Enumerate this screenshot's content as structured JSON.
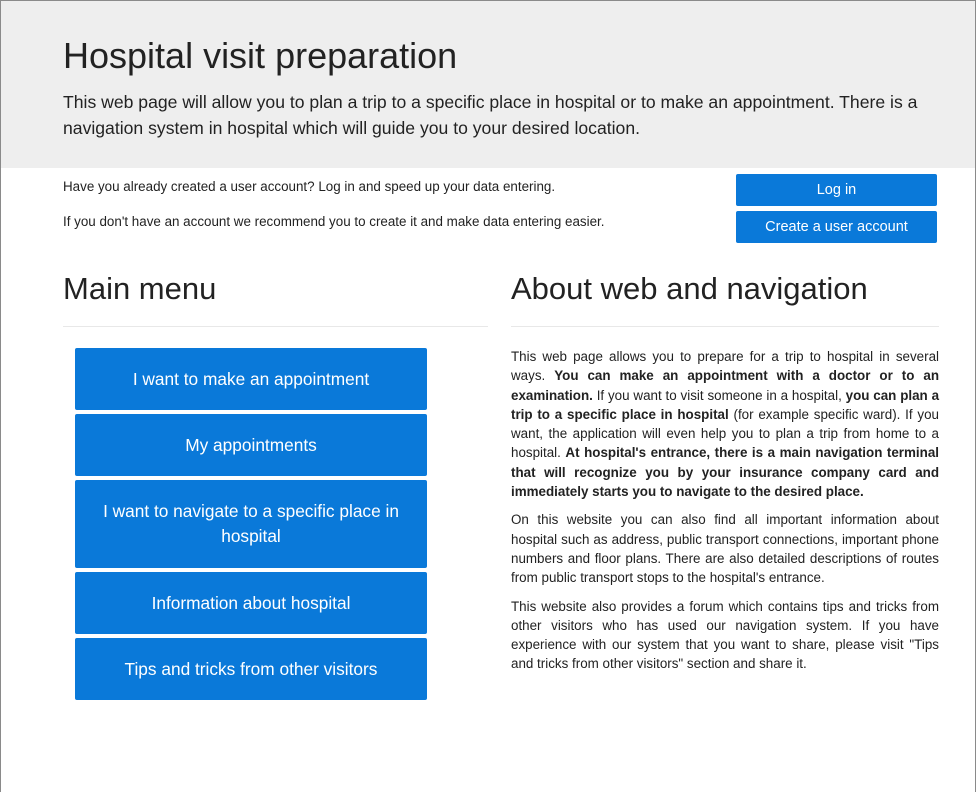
{
  "hero": {
    "title": "Hospital visit preparation",
    "description": "This web page will allow you to plan a trip to a specific place in hospital or to make an appointment. There is a navigation system in hospital which will guide you to your desired location."
  },
  "account": {
    "login_prompt": "Have you already created a user account? Log in and speed up your data entering.",
    "create_prompt": "If you don't have an account we recommend you to create it and make data entering easier.",
    "login_label": "Log in",
    "create_label": "Create a user account"
  },
  "main_menu": {
    "title": "Main menu",
    "items": [
      {
        "label": "I want to make an appointment"
      },
      {
        "label": "My appointments"
      },
      {
        "label": "I want to navigate to a specific place in hospital"
      },
      {
        "label": "Information about hospital"
      },
      {
        "label": "Tips and tricks from other visitors"
      }
    ]
  },
  "about": {
    "title": "About web and navigation",
    "p1": {
      "a": "This web page allows you to prepare for a trip to hospital in several ways. ",
      "b": "You can make an appointment with a doctor or to an examination.",
      "c": " If you want to visit someone in a hospital, ",
      "d": "you can plan a trip to a specific place in hospital",
      "e": " (for example specific ward). If you want, the application will even help you to plan a trip from home to a hospital. ",
      "f": "At hospital's entrance, there is a main navigation terminal that will recognize you by your insurance company card and immediately starts you to navigate to the desired place."
    },
    "p2": "On this website you can also find all important information about hospital such as address, public transport connections, important phone numbers and floor plans. There are also detailed descriptions of routes from public transport stops to the hospital's entrance.",
    "p3": "This website also provides a forum which contains tips and tricks from other visitors who has used our navigation system. If you have experience with our system that you want to share, please visit \"Tips and tricks from other visitors\" section and share it."
  }
}
